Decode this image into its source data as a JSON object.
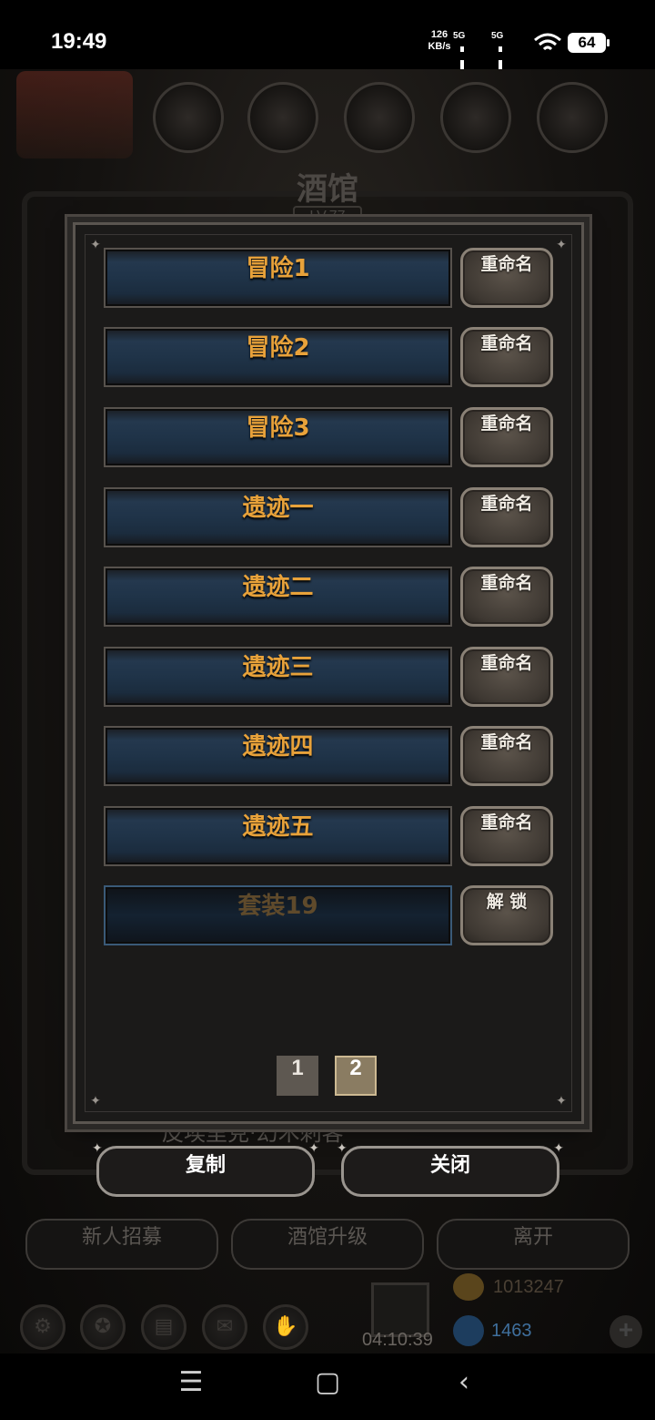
{
  "status_bar": {
    "time": "19:49",
    "net_speed_value": "126",
    "net_speed_unit": "KB/s",
    "sim1": "5G",
    "sim2": "5G",
    "battery": "64"
  },
  "background": {
    "title": "酒馆",
    "level": "LV.77",
    "hero_text": "皮埃里克·幻术刺客",
    "buttons": [
      "新人招募",
      "酒馆升级",
      "离开"
    ],
    "gold": "1013247",
    "gems": "1463",
    "timer": "04:10:39"
  },
  "slots": [
    {
      "name": "冒险1",
      "action": "重命名"
    },
    {
      "name": "冒险2",
      "action": "重命名"
    },
    {
      "name": "冒险3",
      "action": "重命名"
    },
    {
      "name": "遗迹一",
      "action": "重命名"
    },
    {
      "name": "遗迹二",
      "action": "重命名"
    },
    {
      "name": "遗迹三",
      "action": "重命名"
    },
    {
      "name": "遗迹四",
      "action": "重命名"
    },
    {
      "name": "遗迹五",
      "action": "重命名"
    },
    {
      "name": "套装19",
      "action": "解 锁",
      "locked": true
    }
  ],
  "pagination": {
    "pages": [
      "1",
      "2"
    ],
    "current": "2"
  },
  "footer": {
    "copy_label": "复制",
    "close_label": "关闭"
  },
  "icons": {
    "nav_recent": "menu-icon",
    "nav_home": "home-icon",
    "nav_back": "back-icon",
    "hud": [
      "gear-icon",
      "star-badge-icon",
      "scroll-icon",
      "mail-icon",
      "handshake-icon"
    ]
  },
  "colors": {
    "slot_text": "#e8a23a",
    "slot_bg": "#1f3348",
    "button_stone": "#4a433c",
    "panel": "#1b1a19"
  }
}
